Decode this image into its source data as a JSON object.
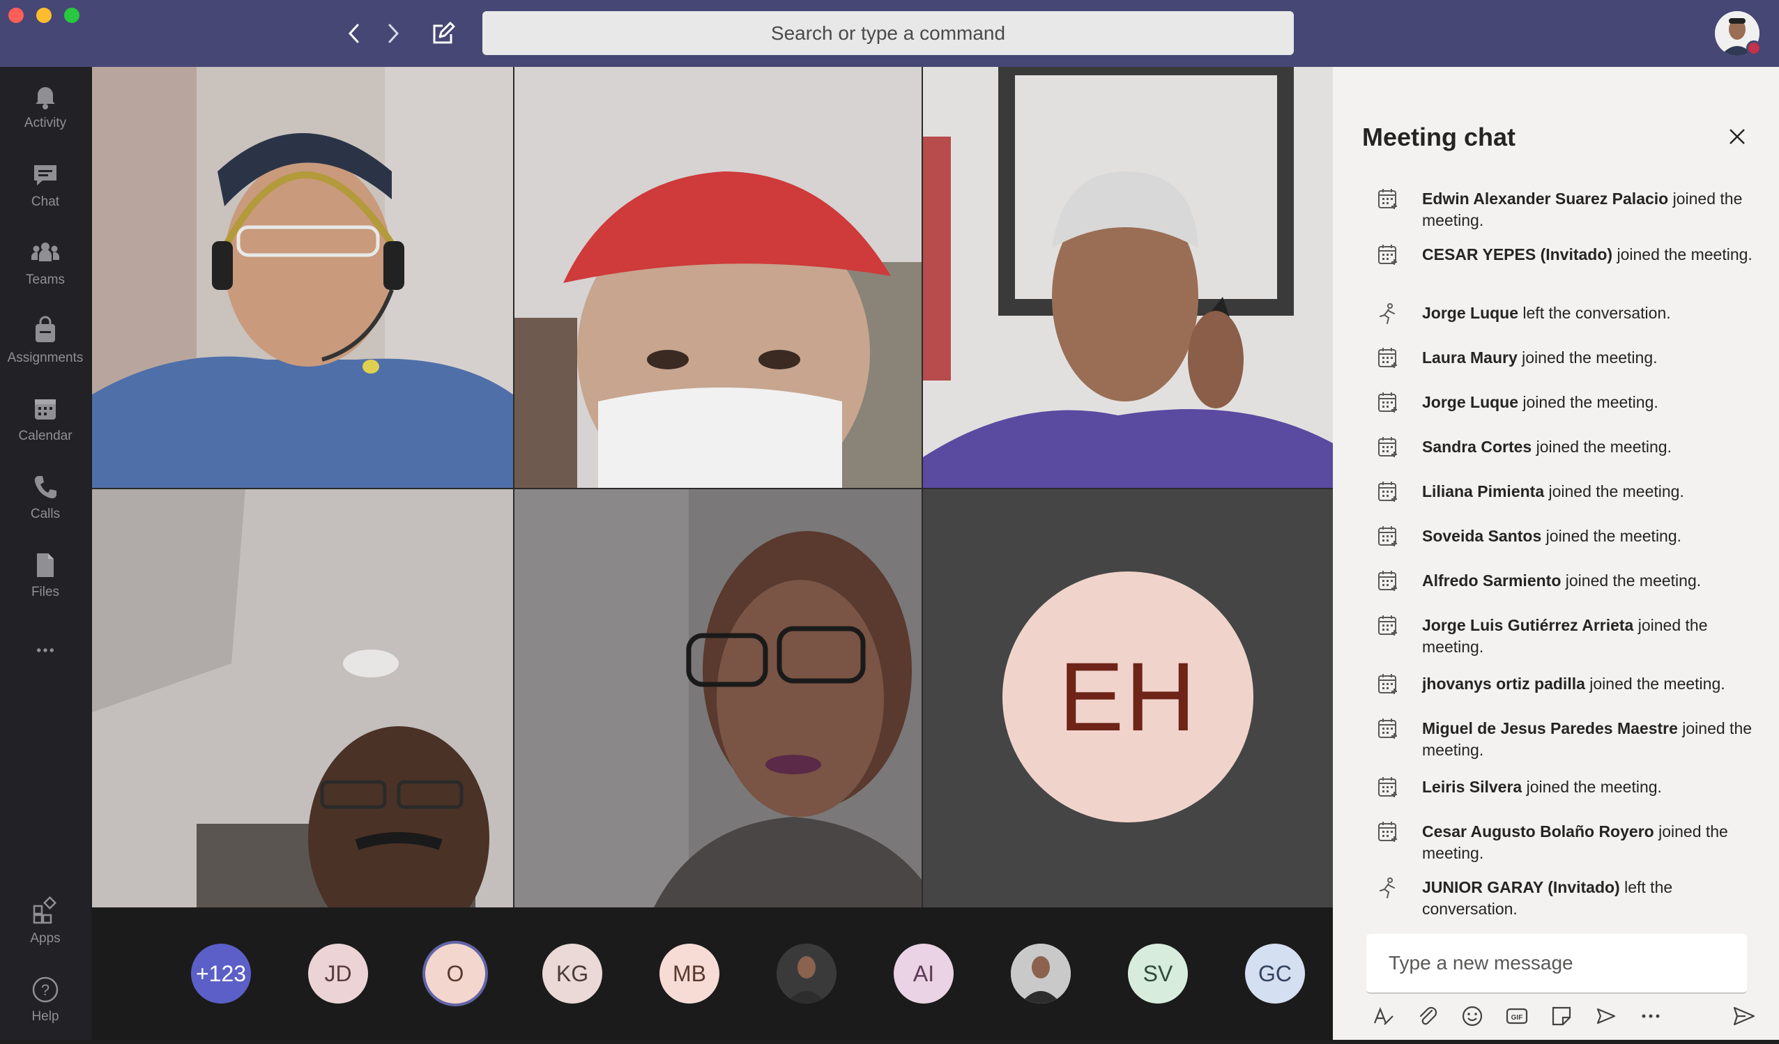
{
  "search": {
    "placeholder": "Search or type a command"
  },
  "window_controls": {
    "close_color": "#ff5f57",
    "minimize_color": "#febc2e",
    "zoom_color": "#28c840"
  },
  "rail": {
    "items": [
      {
        "label": "Activity",
        "icon": "bell-icon"
      },
      {
        "label": "Chat",
        "icon": "chat-icon"
      },
      {
        "label": "Teams",
        "icon": "teams-icon"
      },
      {
        "label": "Assignments",
        "icon": "assignments-icon"
      },
      {
        "label": "Calendar",
        "icon": "calendar-icon"
      },
      {
        "label": "Calls",
        "icon": "phone-icon"
      },
      {
        "label": "Files",
        "icon": "file-icon"
      },
      {
        "label": "Apps",
        "icon": "apps-icon"
      },
      {
        "label": "Help",
        "icon": "help-icon"
      }
    ]
  },
  "stage": {
    "eh_initials": "EH",
    "participants": [
      {
        "initials": "+123",
        "bg": "#5b5fc7",
        "fg": "#ffffff"
      },
      {
        "initials": "JD",
        "bg": "#ecd4d6",
        "fg": "#5a3a3c"
      },
      {
        "initials": "O",
        "bg": "#f3d6cd",
        "fg": "#5a3a30",
        "selected": true
      },
      {
        "initials": "KG",
        "bg": "#ead9d6",
        "fg": "#4b3b3b"
      },
      {
        "initials": "MB",
        "bg": "#f6dcd5",
        "fg": "#5a3a30"
      },
      {
        "initials": "",
        "bg": "#3a3a3a",
        "fg": "#ffffff",
        "photo": true
      },
      {
        "initials": "AI",
        "bg": "#ead3e4",
        "fg": "#5a3a55"
      },
      {
        "initials": "",
        "bg": "#c9c9c9",
        "fg": "#ffffff",
        "photo": true
      },
      {
        "initials": "SV",
        "bg": "#d7ecdd",
        "fg": "#2f4b3a"
      },
      {
        "initials": "GC",
        "bg": "#d4dff1",
        "fg": "#34445e"
      }
    ]
  },
  "chat": {
    "title": "Meeting chat",
    "messages": [
      {
        "name": "Edwin Alexander Suarez Palacio",
        "text": " joined the meeting.",
        "type": "join"
      },
      {
        "name": "CESAR YEPES (Invitado)",
        "text": " joined the meeting.",
        "type": "join"
      },
      {
        "name": "Jorge Luque",
        "text": " left the conversation.",
        "type": "leave"
      },
      {
        "name": "Laura Maury",
        "text": " joined the meeting.",
        "type": "join"
      },
      {
        "name": "Jorge Luque",
        "text": " joined the meeting.",
        "type": "join"
      },
      {
        "name": "Sandra Cortes",
        "text": " joined the meeting.",
        "type": "join"
      },
      {
        "name": "Liliana Pimienta",
        "text": " joined the meeting.",
        "type": "join"
      },
      {
        "name": "Soveida Santos",
        "text": " joined the meeting.",
        "type": "join"
      },
      {
        "name": "Alfredo Sarmiento",
        "text": " joined the meeting.",
        "type": "join"
      },
      {
        "name": "Jorge Luis Gutiérrez Arrieta",
        "text": " joined the meeting.",
        "type": "join"
      },
      {
        "name": "jhovanys ortiz padilla",
        "text": " joined the meeting.",
        "type": "join"
      },
      {
        "name": "Miguel de Jesus Paredes Maestre",
        "text": " joined the meeting.",
        "type": "join"
      },
      {
        "name": "Leiris Silvera",
        "text": " joined the meeting.",
        "type": "join"
      },
      {
        "name": "Cesar Augusto Bolaño Royero",
        "text": " joined the meeting.",
        "type": "join"
      },
      {
        "name": "JUNIOR GARAY (Invitado)",
        "text": " left the conversation.",
        "type": "leave"
      }
    ],
    "compose_placeholder": "Type a new message",
    "tools": [
      "format-icon",
      "attach-icon",
      "emoji-icon",
      "gif-icon",
      "sticker-icon",
      "meet-icon",
      "more-icon",
      "send-icon"
    ]
  }
}
